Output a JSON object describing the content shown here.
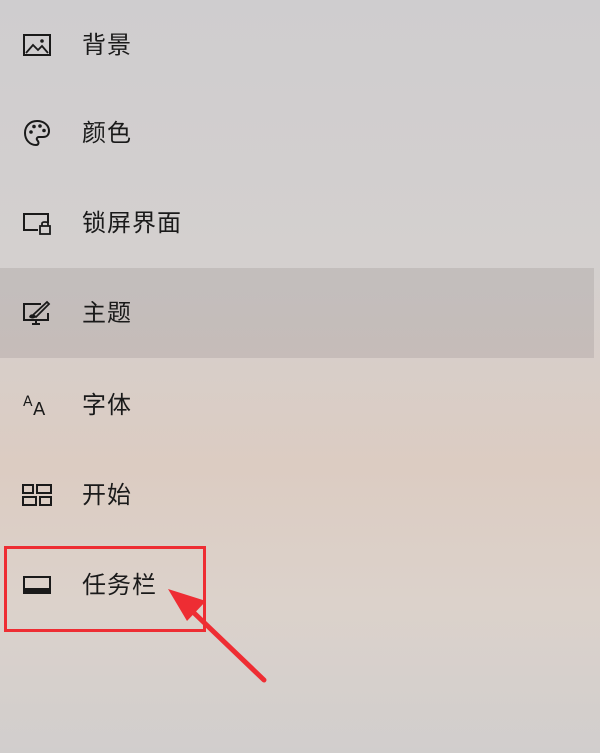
{
  "nav": {
    "items": [
      {
        "label": "背景",
        "icon": "picture-icon",
        "selected": false
      },
      {
        "label": "颜色",
        "icon": "palette-icon",
        "selected": false
      },
      {
        "label": "锁屏界面",
        "icon": "lock-screen-icon",
        "selected": false
      },
      {
        "label": "主题",
        "icon": "theme-icon",
        "selected": true
      },
      {
        "label": "字体",
        "icon": "font-icon",
        "selected": false
      },
      {
        "label": "开始",
        "icon": "start-icon",
        "selected": false
      },
      {
        "label": "任务栏",
        "icon": "taskbar-icon",
        "selected": false
      }
    ]
  },
  "annotation": {
    "color": "#ee2d33",
    "target": "任务栏"
  }
}
